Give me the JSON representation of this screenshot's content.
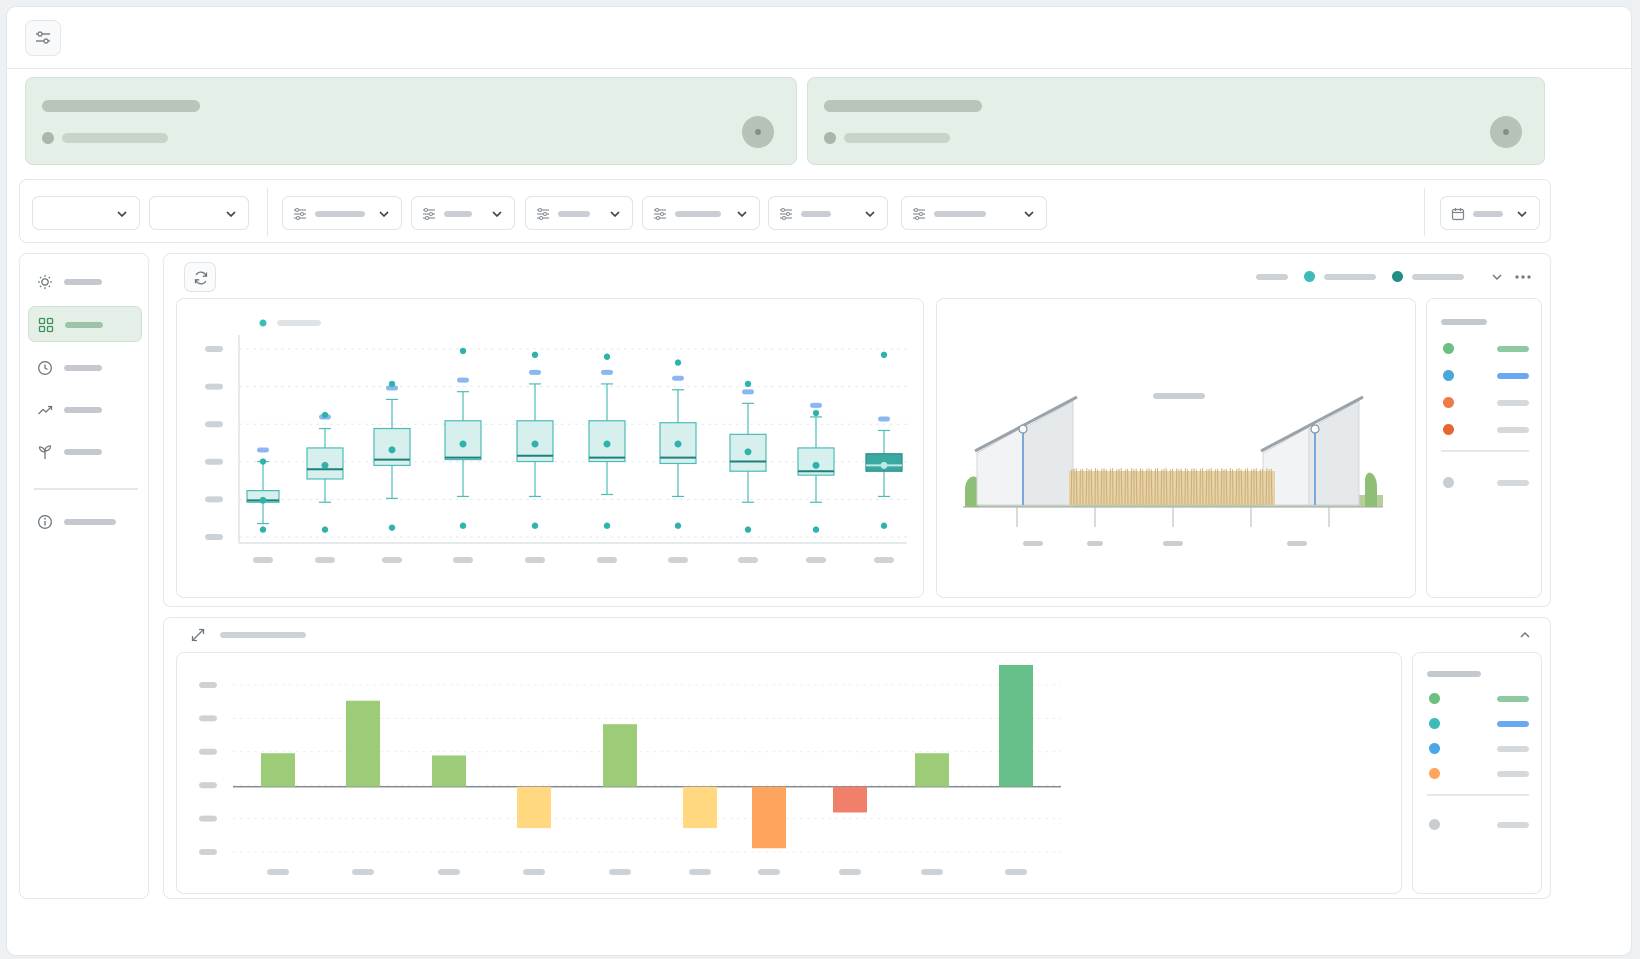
{
  "colors": {
    "accent_green": "#9ccc77",
    "teal": "#3bbcb8",
    "dark_teal": "#1f8f86",
    "blue": "#7fb3f0",
    "yellow": "#ffd880",
    "orange": "#ffa45c",
    "red_orange": "#f0806a",
    "emerald": "#67c08a",
    "card_bg": "#e4efe7"
  },
  "topbar": {
    "icon": "sliders-icon"
  },
  "filters": {
    "left_selects": [
      {
        "icon": "chevron-down-icon"
      },
      {
        "icon": "chevron-down-icon"
      }
    ],
    "filter_selects": [
      {
        "icon": "filter-lines-icon"
      },
      {
        "icon": "filter-lines-icon"
      },
      {
        "icon": "filter-lines-icon"
      },
      {
        "icon": "filter-lines-icon"
      },
      {
        "icon": "filter-lines-icon"
      },
      {
        "icon": "filter-lines-icon"
      }
    ],
    "date_select": {
      "icon": "calendar-icon"
    }
  },
  "sidebar": {
    "items": [
      {
        "icon": "sun-icon",
        "active": false
      },
      {
        "icon": "grid-icon",
        "active": true
      },
      {
        "icon": "clock-icon",
        "active": false
      },
      {
        "icon": "trend-icon",
        "active": false
      },
      {
        "icon": "sprout-icon",
        "active": false
      }
    ],
    "footer_icon": "info-icon"
  },
  "chart_data": [
    {
      "type": "box",
      "categories_count": 10,
      "series": [
        {
          "stat": "box",
          "values": [
            {
              "min": 0.1,
              "q1": 0.21,
              "median": 0.22,
              "q3": 0.27,
              "max": 0.42
            },
            {
              "min": 0.21,
              "q1": 0.33,
              "median": 0.38,
              "q3": 0.49,
              "max": 0.59
            },
            {
              "min": 0.23,
              "q1": 0.4,
              "median": 0.43,
              "q3": 0.59,
              "max": 0.74
            },
            {
              "min": 0.24,
              "q1": 0.43,
              "median": 0.44,
              "q3": 0.63,
              "max": 0.78
            },
            {
              "min": 0.24,
              "q1": 0.42,
              "median": 0.45,
              "q3": 0.63,
              "max": 0.82
            },
            {
              "min": 0.25,
              "q1": 0.42,
              "median": 0.44,
              "q3": 0.63,
              "max": 0.82
            },
            {
              "min": 0.24,
              "q1": 0.41,
              "median": 0.44,
              "q3": 0.62,
              "max": 0.79
            },
            {
              "min": 0.21,
              "q1": 0.37,
              "median": 0.42,
              "q3": 0.56,
              "max": 0.72
            },
            {
              "min": 0.21,
              "q1": 0.35,
              "median": 0.37,
              "q3": 0.49,
              "max": 0.65
            },
            {
              "min": 0.24,
              "q1": 0.37,
              "median": 0.4,
              "q3": 0.46,
              "max": 0.58
            }
          ]
        }
      ],
      "means": [
        0.22,
        0.4,
        0.48,
        0.51,
        0.51,
        0.51,
        0.51,
        0.47,
        0.4,
        0.4
      ],
      "outliers_high": [
        0.42,
        0.66,
        0.82,
        0.99,
        0.97,
        0.96,
        0.93,
        0.82,
        0.67,
        0.97
      ],
      "outliers_low": [
        0.1,
        0.1,
        0.11,
        0.12,
        0.12,
        0.12,
        0.12,
        0.1,
        0.1,
        0.12
      ],
      "ylim": [
        0,
        1
      ]
    },
    {
      "type": "bar",
      "categories_count": 10,
      "values": [
        0.3,
        0.77,
        0.28,
        -0.37,
        0.56,
        -0.37,
        -0.55,
        -0.23,
        0.3,
        1.09
      ],
      "colors": [
        "#9ccc77",
        "#9ccc77",
        "#9ccc77",
        "#ffd880",
        "#9ccc77",
        "#ffd880",
        "#ffa45c",
        "#f0806a",
        "#9ccc77",
        "#67c08a"
      ],
      "ylim": [
        -0.7,
        1.0
      ]
    }
  ],
  "legend_top": {
    "dots": [
      "#3bbcb8",
      "#1f8f86"
    ]
  },
  "side_legend_1": {
    "items": [
      {
        "dot": "#6cbf7e",
        "bar": "#8fc9a2"
      },
      {
        "dot": "#4aa8d8",
        "bar": "#6aa8f0"
      },
      {
        "dot": "#f07a48",
        "bar": "#d5d9dc"
      },
      {
        "dot": "#e8662f",
        "bar": "#d5d9dc"
      },
      {
        "dot": "#c8cdd1",
        "bar": "#d5d9dc"
      }
    ]
  },
  "side_legend_2": {
    "items": [
      {
        "dot": "#6cbf7e",
        "bar": "#8fc9a2"
      },
      {
        "dot": "#3bbcb8",
        "bar": "#6aa8f0"
      },
      {
        "dot": "#4aa8e8",
        "bar": "#d5d9dc"
      },
      {
        "dot": "#ffa45c",
        "bar": "#d5d9dc"
      },
      {
        "dot": "#c8cdd1",
        "bar": "#d5d9dc"
      }
    ]
  }
}
